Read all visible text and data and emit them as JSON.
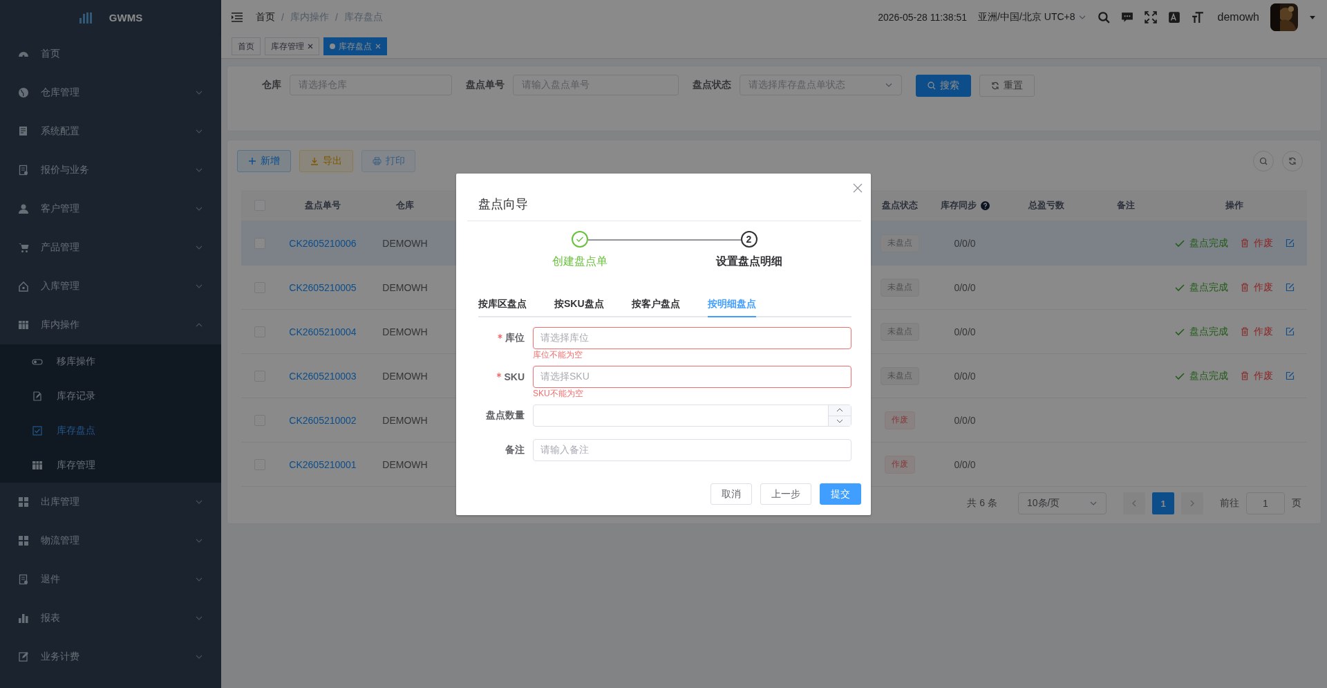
{
  "sidebar": {
    "logo": "GWMS",
    "items": [
      {
        "label": "首页",
        "kind": "link"
      },
      {
        "label": "仓库管理",
        "kind": "menu",
        "expanded": false
      },
      {
        "label": "系统配置",
        "kind": "menu",
        "expanded": false
      },
      {
        "label": "报价与业务",
        "kind": "menu",
        "expanded": false
      },
      {
        "label": "客户管理",
        "kind": "menu",
        "expanded": false
      },
      {
        "label": "产品管理",
        "kind": "menu",
        "expanded": false
      },
      {
        "label": "入库管理",
        "kind": "menu",
        "expanded": false
      },
      {
        "label": "库内操作",
        "kind": "menu",
        "expanded": true,
        "children": [
          {
            "label": "移库操作",
            "selected": false
          },
          {
            "label": "库存记录",
            "selected": false
          },
          {
            "label": "库存盘点",
            "selected": true
          },
          {
            "label": "库存管理",
            "selected": false
          }
        ]
      },
      {
        "label": "出库管理",
        "kind": "menu",
        "expanded": false
      },
      {
        "label": "物流管理",
        "kind": "menu",
        "expanded": false
      },
      {
        "label": "退件",
        "kind": "menu",
        "expanded": false
      },
      {
        "label": "报表",
        "kind": "menu",
        "expanded": false
      },
      {
        "label": "业务计费",
        "kind": "menu",
        "expanded": false
      }
    ]
  },
  "header": {
    "breadcrumb": [
      "首页",
      "库内操作",
      "库存盘点"
    ],
    "breadcrumb_separator": "/",
    "datetime": "2026-05-28 11:38:51",
    "timezone": "亚洲/中国/北京 UTC+8",
    "user": "demowh"
  },
  "tags": [
    {
      "label": "首页",
      "closable": false,
      "selected": false
    },
    {
      "label": "库存管理",
      "closable": true,
      "selected": false
    },
    {
      "label": "库存盘点",
      "closable": true,
      "selected": true
    }
  ],
  "filters": [
    {
      "label": "仓库",
      "placeholder": "请选择仓库",
      "kind": "input"
    },
    {
      "label": "盘点单号",
      "placeholder": "请输入盘点单号",
      "kind": "input"
    },
    {
      "label": "盘点状态",
      "placeholder": "请选择库存盘点单状态",
      "kind": "select"
    }
  ],
  "filter_buttons": [
    {
      "label": "搜索",
      "kind": "primary"
    },
    {
      "label": "重置",
      "kind": "default"
    }
  ],
  "toolbar": [
    {
      "label": "新增",
      "kind": "primary",
      "disabled": false
    },
    {
      "label": "导出",
      "kind": "warning",
      "disabled": false
    },
    {
      "label": "打印",
      "kind": "print",
      "disabled": true
    }
  ],
  "table": {
    "header_checked": false,
    "columns": [
      "盘点单号",
      "仓库",
      "盘点状态",
      "库存同步",
      "总盈亏数",
      "备注",
      "操作"
    ],
    "rows": [
      {
        "checked": false,
        "highlighted": true,
        "id": "CK2605210006",
        "warehouse": "DEMOWH",
        "status": {
          "label": "未盘点",
          "kind": "pending"
        },
        "sync": "0/0/0",
        "actions": [
          {
            "label": "盘点完成",
            "kind": "complete"
          },
          {
            "label": "作废",
            "kind": "void"
          },
          {
            "kind": "edit"
          }
        ]
      },
      {
        "checked": false,
        "highlighted": false,
        "id": "CK2605210005",
        "warehouse": "DEMOWH",
        "status": {
          "label": "未盘点",
          "kind": "pending"
        },
        "sync": "0/0/0",
        "actions": [
          {
            "label": "盘点完成",
            "kind": "complete"
          },
          {
            "label": "作废",
            "kind": "void"
          },
          {
            "kind": "edit"
          }
        ]
      },
      {
        "checked": false,
        "highlighted": false,
        "id": "CK2605210004",
        "warehouse": "DEMOWH",
        "status": {
          "label": "未盘点",
          "kind": "pending"
        },
        "sync": "0/0/0",
        "actions": [
          {
            "label": "盘点完成",
            "kind": "complete"
          },
          {
            "label": "作废",
            "kind": "void"
          },
          {
            "kind": "edit"
          }
        ]
      },
      {
        "checked": false,
        "highlighted": false,
        "id": "CK2605210003",
        "warehouse": "DEMOWH",
        "status": {
          "label": "未盘点",
          "kind": "pending"
        },
        "sync": "0/0/0",
        "actions": [
          {
            "label": "盘点完成",
            "kind": "complete"
          },
          {
            "label": "作废",
            "kind": "void"
          },
          {
            "kind": "edit"
          }
        ]
      },
      {
        "checked": false,
        "highlighted": false,
        "id": "CK2605210002",
        "warehouse": "DEMOWH",
        "status": {
          "label": "作废",
          "kind": "void"
        },
        "sync": "0/0/0"
      },
      {
        "checked": false,
        "highlighted": false,
        "id": "CK2605210001",
        "warehouse": "DEMOWH",
        "status": {
          "label": "作废",
          "kind": "void"
        },
        "sync": "0/0/0"
      }
    ]
  },
  "pagination": {
    "total": "共 6 条",
    "page_size": "10条/页",
    "pages": [
      {
        "label": "1",
        "selected": true
      }
    ],
    "goto_label": "前往",
    "goto_value": "1",
    "goto_suffix": "页"
  },
  "dialog": {
    "title": "盘点向导",
    "steps": [
      {
        "label": "创建盘点单",
        "completed": true
      },
      {
        "label": "设置盘点明细",
        "completed": false,
        "number": "2"
      }
    ],
    "tabs": [
      {
        "label": "按库区盘点",
        "selected": false
      },
      {
        "label": "按SKU盘点",
        "selected": false
      },
      {
        "label": "按客户盘点",
        "selected": false
      },
      {
        "label": "按明细盘点",
        "selected": true
      }
    ],
    "fields": [
      {
        "label": "库位",
        "required": true,
        "kind": "select",
        "placeholder": "请选择库位",
        "error": "库位不能为空"
      },
      {
        "label": "SKU",
        "required": true,
        "kind": "select",
        "placeholder": "请选择SKU",
        "error": "SKU不能为空"
      },
      {
        "label": "盘点数量",
        "required": false,
        "kind": "number"
      },
      {
        "label": "备注",
        "required": false,
        "kind": "input",
        "placeholder": "请输入备注"
      }
    ],
    "buttons": [
      {
        "label": "取消",
        "kind": "default"
      },
      {
        "label": "上一步",
        "kind": "default"
      },
      {
        "label": "提交",
        "kind": "primary"
      }
    ]
  }
}
